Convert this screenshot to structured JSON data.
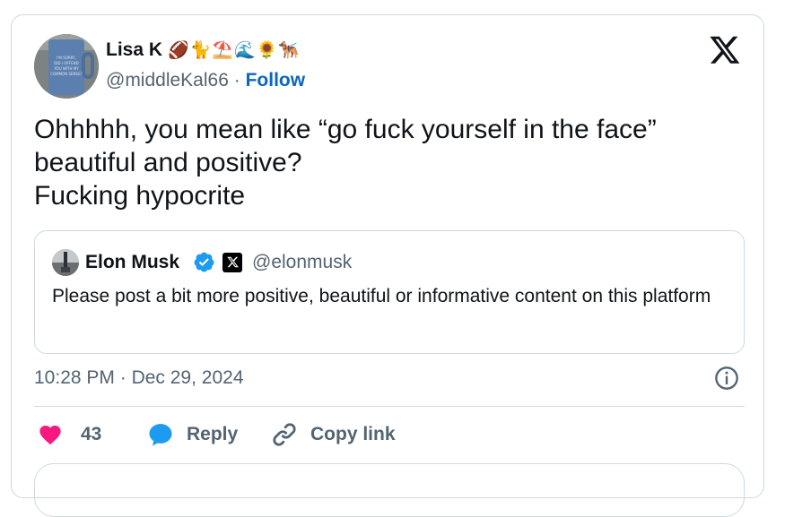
{
  "tweet": {
    "author": {
      "name": "Lisa K",
      "emoji": "🏈🐈⛱️🌊🌻🐕‍🦺",
      "handle": "@middleKal66",
      "separator": "·",
      "follow_label": "Follow",
      "avatar_text": "I'M SORRY, DID I OFFEND YOU WITH MY COMMON SENSE?"
    },
    "text_lines": [
      "Ohhhhh, you mean like “go fuck yourself in the face”",
      "beautiful and positive?",
      "Fucking hypocrite"
    ],
    "quoted": {
      "name": "Elon Musk",
      "handle": "@elonmusk",
      "text": "Please post a bit more positive, beautiful or informative content on this platform"
    },
    "time": "10:28 PM",
    "date_separator": "·",
    "date": "Dec 29, 2024",
    "actions": {
      "likes": "43",
      "reply_label": "Reply",
      "copy_link_label": "Copy link"
    }
  },
  "colors": {
    "text": "#0f1419",
    "muted": "#536471",
    "link": "#0a66c2",
    "heart": "#f91880",
    "reply": "#1d9bf0",
    "verified": "#1d9bf0",
    "border": "#cfd9de"
  },
  "icons": [
    "x-logo-icon",
    "verified-badge-icon",
    "x-badge-icon",
    "info-icon",
    "heart-icon",
    "reply-bubble-icon",
    "link-icon"
  ]
}
